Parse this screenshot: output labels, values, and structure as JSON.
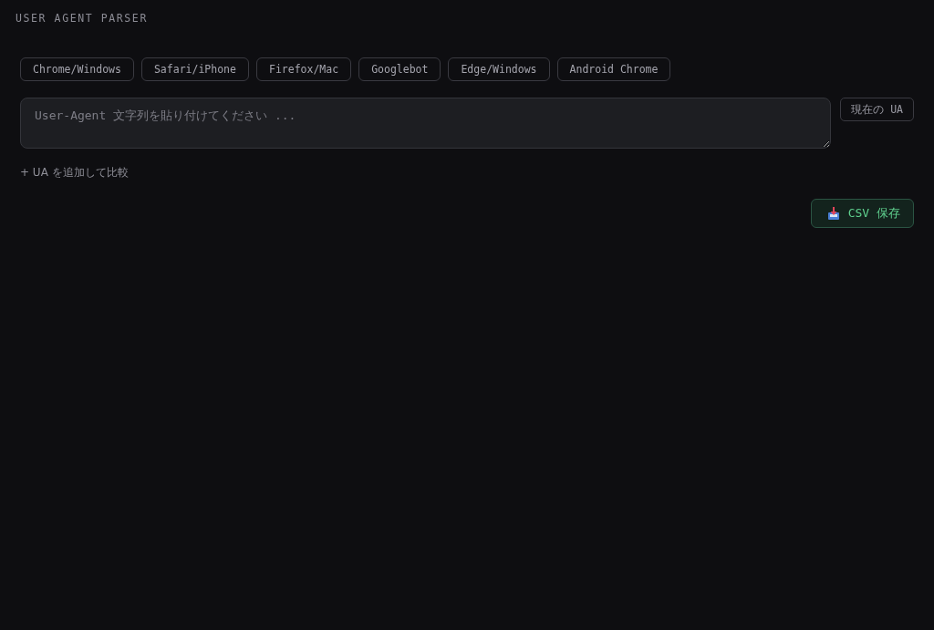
{
  "title": "USER AGENT PARSER",
  "presets": [
    "Chrome/Windows",
    "Safari/iPhone",
    "Firefox/Mac",
    "Googlebot",
    "Edge/Windows",
    "Android Chrome"
  ],
  "input": {
    "placeholder": "User-Agent 文字列を貼り付けてください ..."
  },
  "current_ua_button": "現在の UA",
  "add_link": "+ UA を追加して比較",
  "save_button": {
    "label": "CSV 保存"
  }
}
